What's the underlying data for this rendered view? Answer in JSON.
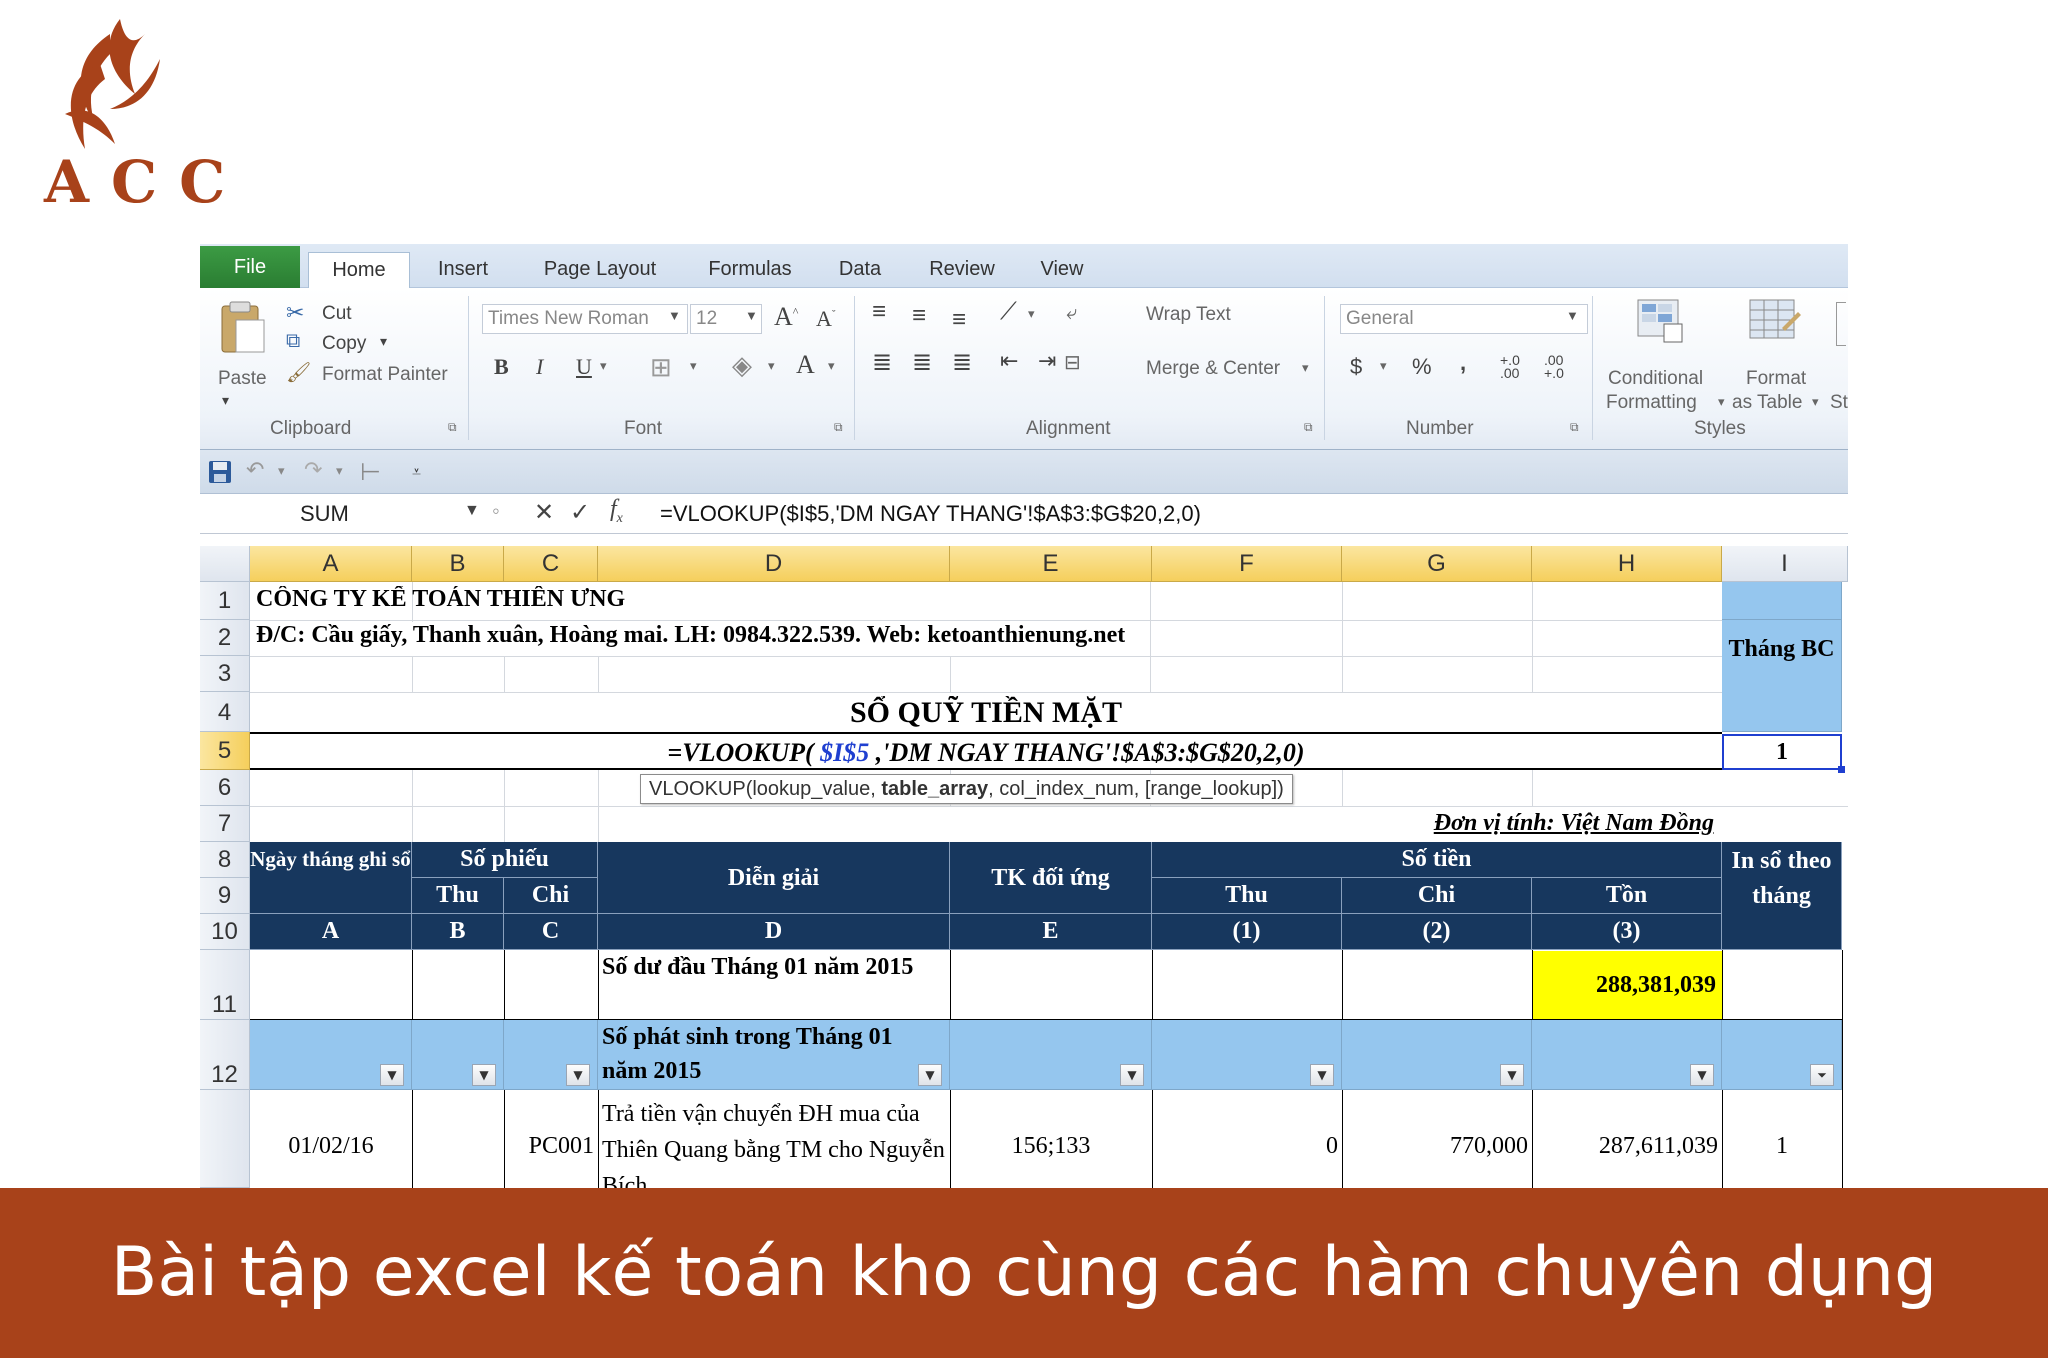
{
  "brand": {
    "logo_text": "ACC",
    "color": "#a8421a"
  },
  "excel": {
    "tabs": [
      "File",
      "Home",
      "Insert",
      "Page Layout",
      "Formulas",
      "Data",
      "Review",
      "View"
    ],
    "active_tab": "Home",
    "ribbon": {
      "clipboard": {
        "paste": "Paste",
        "cut": "Cut",
        "copy": "Copy",
        "format_painter": "Format Painter",
        "label": "Clipboard"
      },
      "font": {
        "name": "Times New Roman",
        "size": "12",
        "label": "Font"
      },
      "alignment": {
        "wrap_text": "Wrap Text",
        "merge_center": "Merge & Center",
        "label": "Alignment"
      },
      "number": {
        "format": "General",
        "label": "Number",
        "currency": "$",
        "percent": "%",
        "comma": ",",
        "inc_decimal": "+.0 .00",
        "dec_decimal": ".00 +.0"
      },
      "styles": {
        "conditional_1": "Conditional",
        "conditional_2": "Formatting",
        "format_1": "Format",
        "format_2": "as Table",
        "cell_styles": "St",
        "label": "Styles"
      }
    },
    "name_box": "SUM",
    "formula": "=VLOOKUP($I$5,'DM NGAY THANG'!$A$3:$G$20,2,0)",
    "columns": [
      "A",
      "B",
      "C",
      "D",
      "E",
      "F",
      "G",
      "H",
      "I"
    ],
    "rows": [
      "1",
      "2",
      "3",
      "4",
      "5",
      "6",
      "7",
      "8",
      "9",
      "10",
      "11",
      "12"
    ],
    "sheet": {
      "company": "CÔNG TY KẾ TOÁN THIÊN ƯNG",
      "address": "Đ/C: Cầu giấy, Thanh xuân, Hoàng mai. LH: 0984.322.539. Web: ketoanthienung.net",
      "title": "SỔ QUỸ TIỀN MẶT",
      "formula_part1": "=VLOOKUP( ",
      "formula_ref": "$I$5",
      "formula_part2": " ,'DM NGAY THANG'!$A$3:$G$20,2,0)",
      "tooltip_1": "VLOOKUP(lookup_value, ",
      "tooltip_bold": "table_array",
      "tooltip_2": ", col_index_num, [range_lookup])",
      "unit": "Đơn vị tính: Việt Nam Đồng",
      "thang_bc": "Tháng BC",
      "i5_value": "1",
      "hdr_ngay": "Ngày tháng ghi sổ",
      "hdr_so_phieu": "Số phiếu",
      "hdr_thu": "Thu",
      "hdr_chi": "Chi",
      "hdr_dien_giai": "Diễn giải",
      "hdr_tk": "TK đối ứng",
      "hdr_so_tien": "Số tiền",
      "hdr_ton": "Tồn",
      "hdr_in_so": "In sổ theo tháng",
      "code_a": "A",
      "code_b": "B",
      "code_c": "C",
      "code_d": "D",
      "code_e": "E",
      "code_1": "(1)",
      "code_2": "(2)",
      "code_3": "(3)",
      "opening_label": "Số dư đầu Tháng 01 năm 2015",
      "opening_balance": "288,381,039",
      "period_label": "Số phát sinh trong Tháng 01 năm 2015",
      "row13": {
        "date": "01/02/16",
        "voucher_chi": "PC001",
        "description": "Trả tiền vận chuyển ĐH mua của Thiên Quang bằng TM cho",
        "description_cut": "Nguyễn Bích",
        "account": "156;133",
        "thu": "0",
        "chi": "770,000",
        "ton": "287,611,039",
        "in_so": "1"
      }
    }
  },
  "banner": {
    "text": "Bài tập excel kế toán kho cùng các hàm chuyên dụng",
    "color": "#a8421a"
  }
}
